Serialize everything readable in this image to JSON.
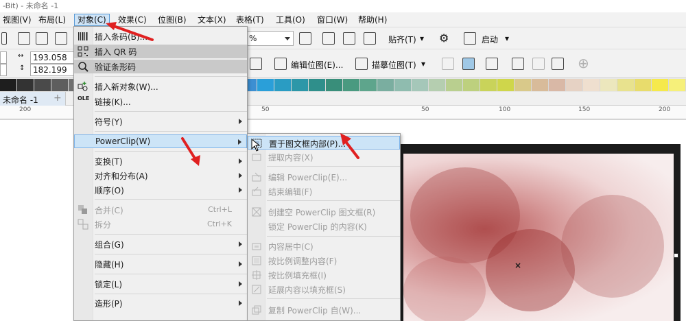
{
  "window": {
    "title": "-Bit) - 未命名 -1"
  },
  "menubar": {
    "items": [
      "视图(V)",
      "布局(L)",
      "对象(C)",
      "效果(C)",
      "位图(B)",
      "文本(X)",
      "表格(T)",
      "工具(O)",
      "窗口(W)",
      "帮助(H)"
    ]
  },
  "toolbar": {
    "zoom_value": "%",
    "snap_label": "贴齐(T)",
    "launch_label": "启动",
    "edit_bitmap_label": "编辑位图(E)...",
    "trace_bitmap_label": "描摹位图(T)",
    "width_value": "193.058 mm",
    "height_value": "182.199 mm"
  },
  "palette": {
    "colors": [
      "#1e1e1e",
      "#333333",
      "#4a4a4a",
      "#5e5e5e",
      "#717171",
      "#858585",
      "#999999",
      "#adadad",
      "#c2c2c2",
      "#d6d6d6",
      "#7b74b6",
      "#6660a6",
      "#5b6fb3",
      "#4f7cc1",
      "#3c8fd2",
      "#2a9fd9",
      "#2a9cc3",
      "#2c97a8",
      "#2f8f8b",
      "#398e7a",
      "#4a9a80",
      "#5ea58c",
      "#7aaea0",
      "#8fbcaf",
      "#a5c7b9",
      "#b5ceb0",
      "#b9cf8f",
      "#bdd07e",
      "#c9d35a",
      "#cfd64b",
      "#d9c98a",
      "#d8bb9a",
      "#d9b8a6",
      "#e6d2c4",
      "#efdfcf",
      "#ece7bd",
      "#e8e28e",
      "#e8dc6c",
      "#f5e94c",
      "#f6f07a"
    ]
  },
  "document": {
    "tab_label": "未命名 -1"
  },
  "ruler": {
    "labels": [
      "200",
      "50",
      "50",
      "100",
      "150",
      "200"
    ]
  },
  "object_menu": {
    "items": [
      {
        "label": "插入条码(B)...",
        "icon": "barcode-icon"
      },
      {
        "label": "插入 QR 码",
        "icon": "qr-code-icon"
      },
      {
        "label": "验证条形码",
        "icon": "verify-barcode-icon"
      },
      {
        "label": "插入新对象(W)...",
        "icon": "insert-object-icon"
      },
      {
        "label": "链接(K)...",
        "icon": "ole-link-icon"
      },
      {
        "label": "符号(Y)"
      },
      {
        "label": "PowerClip(W)"
      },
      {
        "label": "变换(T)"
      },
      {
        "label": "对齐和分布(A)"
      },
      {
        "label": "顺序(O)"
      },
      {
        "label": "合并(C)",
        "shortcut": "Ctrl+L",
        "icon": "combine-icon"
      },
      {
        "label": "拆分",
        "shortcut": "Ctrl+K",
        "icon": "break-apart-icon"
      },
      {
        "label": "组合(G)"
      },
      {
        "label": "隐藏(H)"
      },
      {
        "label": "锁定(L)"
      },
      {
        "label": "造形(P)"
      }
    ]
  },
  "powerclip_menu": {
    "items": [
      {
        "label": "置于图文框内部(P)...",
        "icon": "place-in-frame-icon"
      },
      {
        "label": "提取内容(X)",
        "icon": "extract-contents-icon"
      },
      {
        "label": "编辑 PowerClip(E)...",
        "icon": "edit-powerclip-icon"
      },
      {
        "label": "结束编辑(F)",
        "icon": "finish-editing-icon"
      },
      {
        "label": "创建空 PowerClip 图文框(R)",
        "icon": "create-frame-icon"
      },
      {
        "label": "锁定 PowerClip 的内容(K)"
      },
      {
        "label": "内容居中(C)",
        "icon": "center-contents-icon"
      },
      {
        "label": "按比例调整内容(F)",
        "icon": "fit-proportionally-icon"
      },
      {
        "label": "按比例填充框(I)",
        "icon": "fill-frame-icon"
      },
      {
        "label": "延展内容以填充框(S)",
        "icon": "stretch-contents-icon"
      },
      {
        "label": "复制 PowerClip 自(W)...",
        "icon": "copy-powerclip-icon"
      }
    ]
  },
  "colors": {
    "menu_hover": "#cce4f7",
    "menu_highlight": "#c9c9c9",
    "annotation_arrow": "#e02020"
  }
}
